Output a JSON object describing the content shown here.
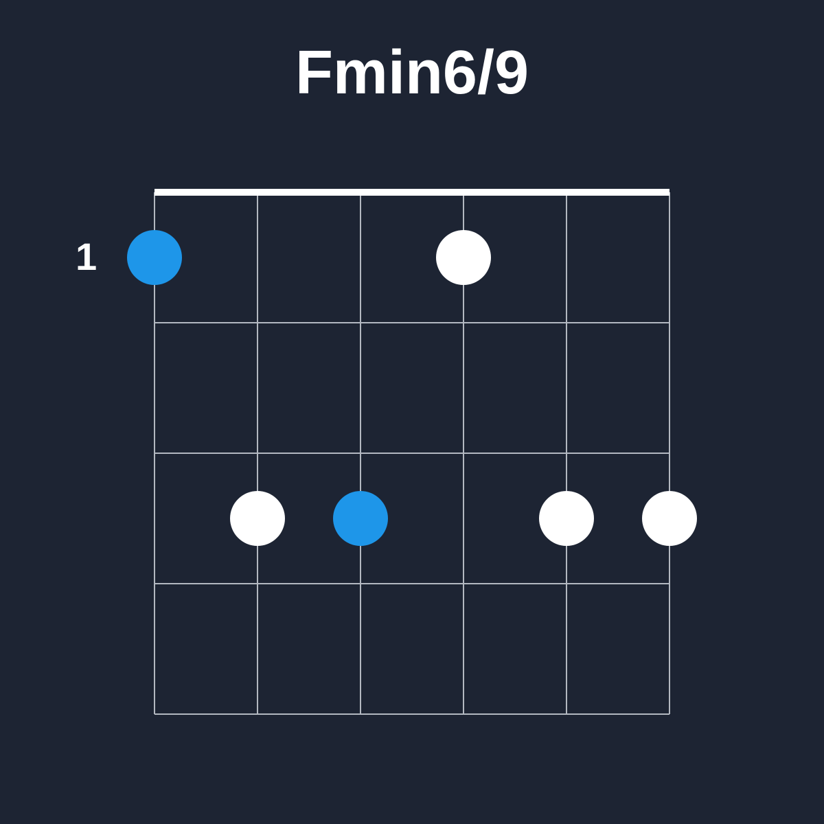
{
  "chord": {
    "name": "Fmin6/9",
    "start_fret_label": "1",
    "start_fret": 1,
    "num_frets": 4,
    "num_strings": 6,
    "show_nut": true,
    "colors": {
      "background": "#1d2433",
      "grid": "#b3b8c1",
      "nut": "#ffffff",
      "dot_root": "#1e96e9",
      "dot_other": "#ffffff",
      "text": "#ffffff"
    },
    "dots": [
      {
        "string": 6,
        "fret": 1,
        "root": true
      },
      {
        "string": 5,
        "fret": 3,
        "root": false
      },
      {
        "string": 4,
        "fret": 3,
        "root": true
      },
      {
        "string": 3,
        "fret": 1,
        "root": false
      },
      {
        "string": 2,
        "fret": 3,
        "root": false
      },
      {
        "string": 1,
        "fret": 3,
        "root": false
      }
    ]
  },
  "layout": {
    "string_spacing": 150,
    "fret_spacing": 190,
    "dot_radius": 40,
    "svg_padding": 10,
    "label_offset_x": -115
  }
}
